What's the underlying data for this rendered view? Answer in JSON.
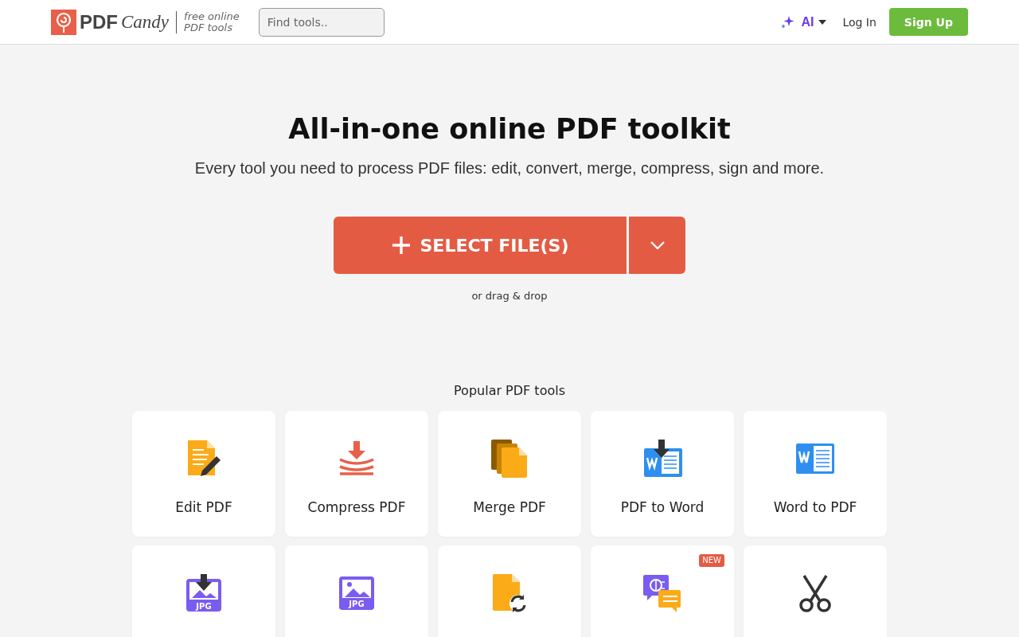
{
  "header": {
    "logo": {
      "word_1": "PDF",
      "word_2": "Candy"
    },
    "tagline": [
      "free online",
      "PDF tools"
    ],
    "search": {
      "placeholder": "Find tools.."
    },
    "ai_menu": {
      "label": "AI",
      "expanded": false
    },
    "login": "Log In",
    "signup": "Sign Up"
  },
  "hero": {
    "title": "All-in-one online PDF toolkit",
    "subtitle": "Every tool you need to process PDF files: edit, convert, merge, compress, sign and more.",
    "select_button": "SELECT FILE(S)",
    "hint": "or drag & drop"
  },
  "tools_section": {
    "heading": "Popular PDF tools",
    "tools": [
      {
        "kind": "edit",
        "label": "Edit PDF"
      },
      {
        "kind": "compress",
        "label": "Compress PDF"
      },
      {
        "kind": "merge",
        "label": "Merge PDF"
      },
      {
        "kind": "pdf-to-word",
        "label": "PDF to Word"
      },
      {
        "kind": "word-to-pdf",
        "label": "Word to PDF"
      },
      {
        "kind": "jpg-to-pdf",
        "icon_text": "JPG"
      },
      {
        "kind": "pdf-to-jpg",
        "icon_text": "JPG"
      },
      {
        "kind": "convert"
      },
      {
        "kind": "chat",
        "badge": "NEW"
      },
      {
        "kind": "split"
      }
    ]
  }
}
